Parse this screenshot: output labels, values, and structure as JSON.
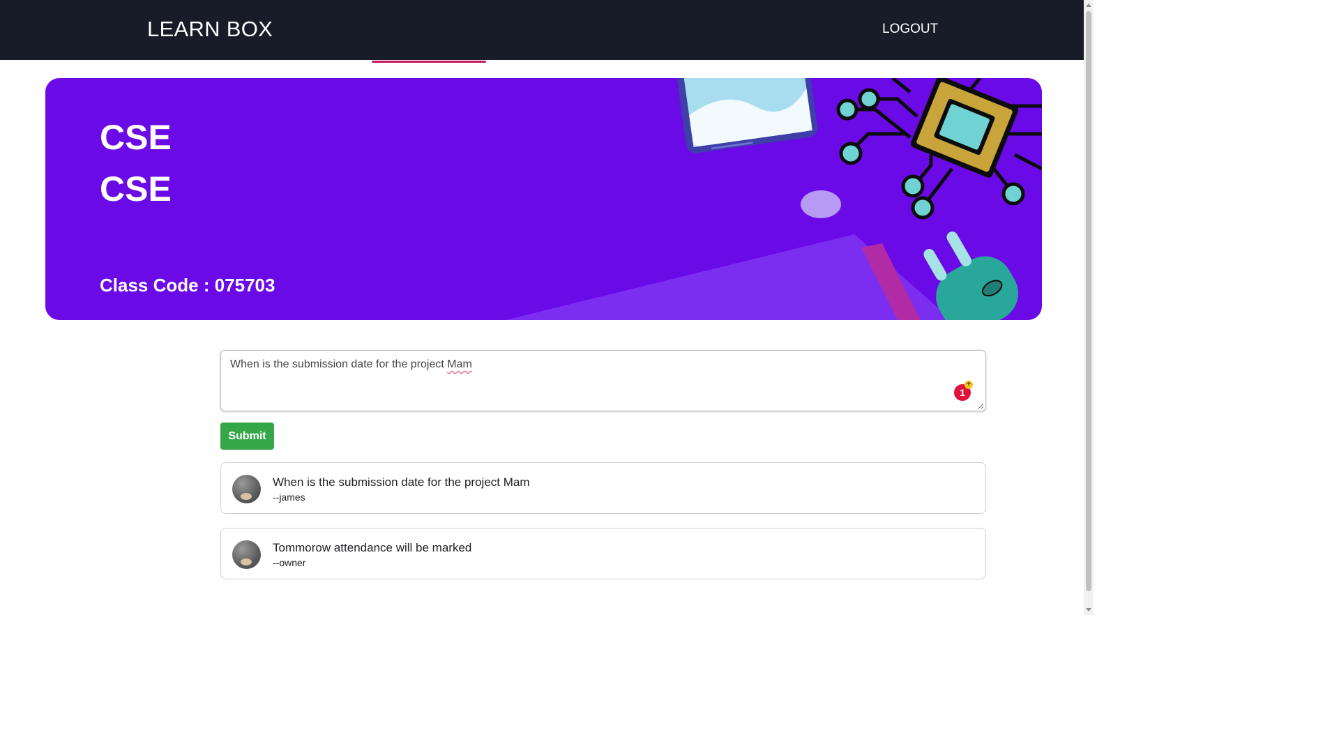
{
  "header": {
    "brand": "LEARN BOX",
    "logout_label": "LOGOUT"
  },
  "banner": {
    "class_name": "CSE",
    "class_section": "CSE",
    "class_code_text": "Class Code : 075703"
  },
  "post_input": {
    "value_prefix": "When is the submission date for the project ",
    "value_flagged_word": "Mam",
    "grammar_issue_count": "1",
    "grammar_plus": "+"
  },
  "submit_label": "Submit",
  "announcements": [
    {
      "text": "When is the submission date for the project Mam",
      "author": "--james"
    },
    {
      "text": "Tommorow attendance will be marked",
      "author": "--owner"
    }
  ],
  "colors": {
    "topbar": "#171c28",
    "banner": "#6a0ae6",
    "tab_indicator": "#c2185b",
    "submit": "#34a849",
    "grammar_badge": "#e0123c"
  }
}
